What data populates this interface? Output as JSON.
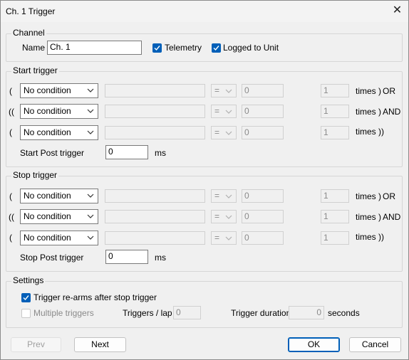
{
  "window": {
    "title": "Ch. 1 Trigger",
    "close_glyph": "✕"
  },
  "channel": {
    "group_label": "Channel",
    "name_label": "Name",
    "name_value": "Ch. 1",
    "telemetry_label": "Telemetry",
    "telemetry_checked": true,
    "logged_label": "Logged to Unit",
    "logged_checked": true
  },
  "start_trigger": {
    "group_label": "Start trigger",
    "rows": [
      {
        "open": "(",
        "condition": "No condition",
        "operator": "=",
        "value": "0",
        "times": "1",
        "close": "times )",
        "logic": "OR"
      },
      {
        "open": "((",
        "condition": "No condition",
        "operator": "=",
        "value": "0",
        "times": "1",
        "close": "times )",
        "logic": "AND"
      },
      {
        "open": "(",
        "condition": "No condition",
        "operator": "=",
        "value": "0",
        "times": "1",
        "close": "times ))",
        "logic": ""
      }
    ],
    "post_label": "Start Post trigger",
    "post_value": "0",
    "post_unit": "ms"
  },
  "stop_trigger": {
    "group_label": "Stop trigger",
    "rows": [
      {
        "open": "(",
        "condition": "No condition",
        "operator": "=",
        "value": "0",
        "times": "1",
        "close": "times )",
        "logic": "OR"
      },
      {
        "open": "((",
        "condition": "No condition",
        "operator": "=",
        "value": "0",
        "times": "1",
        "close": "times )",
        "logic": "AND"
      },
      {
        "open": "(",
        "condition": "No condition",
        "operator": "=",
        "value": "0",
        "times": "1",
        "close": "times ))",
        "logic": ""
      }
    ],
    "post_label": "Stop Post trigger",
    "post_value": "0",
    "post_unit": "ms"
  },
  "settings": {
    "group_label": "Settings",
    "rearm_label": "Trigger re-arms after stop trigger",
    "rearm_checked": true,
    "multiple_label": "Multiple triggers",
    "multiple_checked": false,
    "per_lap_label": "Triggers / lap",
    "per_lap_value": "0",
    "duration_label": "Trigger duration",
    "duration_value": "0",
    "duration_unit": "seconds"
  },
  "buttons": {
    "prev": "Prev",
    "next": "Next",
    "ok": "OK",
    "cancel": "Cancel"
  },
  "colors": {
    "accent": "#005fb8",
    "background": "#f0f0f0"
  }
}
